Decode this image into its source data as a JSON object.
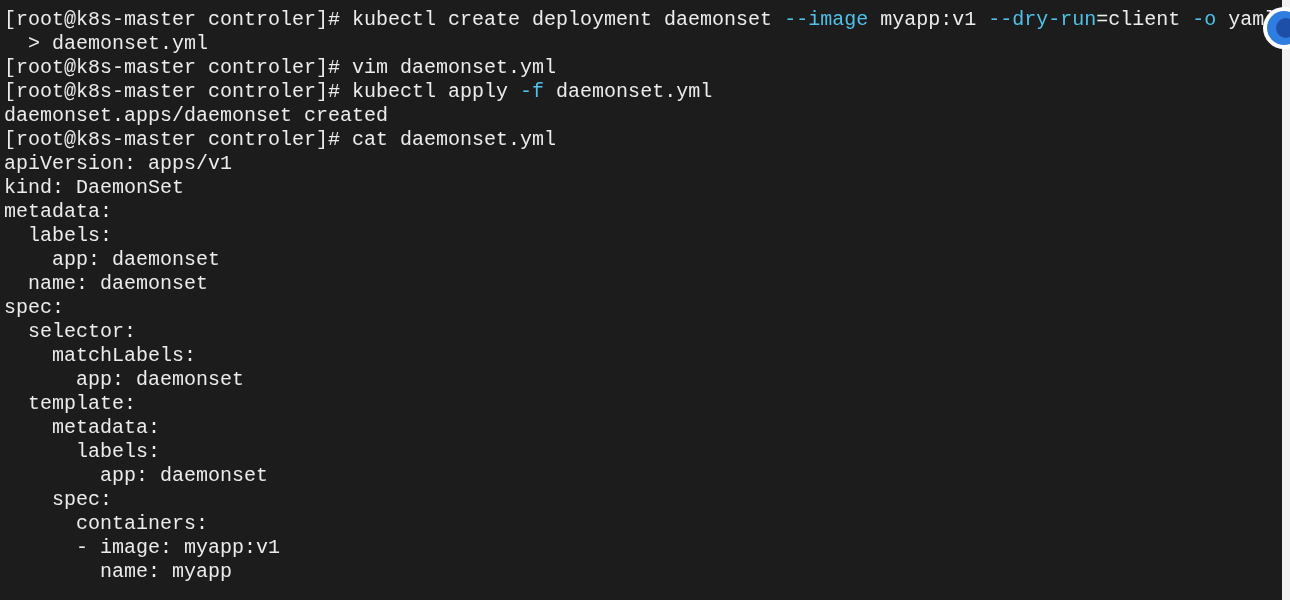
{
  "terminal": {
    "lines": [
      {
        "segments": [
          {
            "text": "[root@k8s-master controler]# kubectl create deployment daemonset ",
            "kind": "plain"
          },
          {
            "text": "--image",
            "kind": "option"
          },
          {
            "text": " myapp:v1 ",
            "kind": "plain"
          },
          {
            "text": "--dry-run",
            "kind": "option"
          },
          {
            "text": "=client ",
            "kind": "plain"
          },
          {
            "text": "-o",
            "kind": "option"
          },
          {
            "text": " yaml",
            "kind": "plain"
          }
        ]
      },
      {
        "segments": [
          {
            "text": "  > daemonset.yml",
            "kind": "plain"
          }
        ]
      },
      {
        "segments": [
          {
            "text": "[root@k8s-master controler]# vim daemonset.yml",
            "kind": "plain"
          }
        ]
      },
      {
        "segments": [
          {
            "text": "[root@k8s-master controler]# kubectl apply ",
            "kind": "plain"
          },
          {
            "text": "-f",
            "kind": "option"
          },
          {
            "text": " daemonset.yml",
            "kind": "plain"
          }
        ]
      },
      {
        "segments": [
          {
            "text": "daemonset.apps/daemonset created",
            "kind": "plain"
          }
        ]
      },
      {
        "segments": [
          {
            "text": "[root@k8s-master controler]# cat daemonset.yml",
            "kind": "plain"
          }
        ]
      },
      {
        "segments": [
          {
            "text": "apiVersion: apps/v1",
            "kind": "plain"
          }
        ]
      },
      {
        "segments": [
          {
            "text": "kind: DaemonSet",
            "kind": "plain"
          }
        ]
      },
      {
        "segments": [
          {
            "text": "metadata:",
            "kind": "plain"
          }
        ]
      },
      {
        "segments": [
          {
            "text": "  labels:",
            "kind": "plain"
          }
        ]
      },
      {
        "segments": [
          {
            "text": "    app: daemonset",
            "kind": "plain"
          }
        ]
      },
      {
        "segments": [
          {
            "text": "  name: daemonset",
            "kind": "plain"
          }
        ]
      },
      {
        "segments": [
          {
            "text": "spec:",
            "kind": "plain"
          }
        ]
      },
      {
        "segments": [
          {
            "text": "  selector:",
            "kind": "plain"
          }
        ]
      },
      {
        "segments": [
          {
            "text": "    matchLabels:",
            "kind": "plain"
          }
        ]
      },
      {
        "segments": [
          {
            "text": "      app: daemonset",
            "kind": "plain"
          }
        ]
      },
      {
        "segments": [
          {
            "text": "  template:",
            "kind": "plain"
          }
        ]
      },
      {
        "segments": [
          {
            "text": "    metadata:",
            "kind": "plain"
          }
        ]
      },
      {
        "segments": [
          {
            "text": "      labels:",
            "kind": "plain"
          }
        ]
      },
      {
        "segments": [
          {
            "text": "        app: daemonset",
            "kind": "plain"
          }
        ]
      },
      {
        "segments": [
          {
            "text": "    spec:",
            "kind": "plain"
          }
        ]
      },
      {
        "segments": [
          {
            "text": "      containers:",
            "kind": "plain"
          }
        ]
      },
      {
        "segments": [
          {
            "text": "      - image: myapp:v1",
            "kind": "plain"
          }
        ]
      },
      {
        "segments": [
          {
            "text": "        name: myapp",
            "kind": "plain"
          }
        ]
      }
    ]
  }
}
